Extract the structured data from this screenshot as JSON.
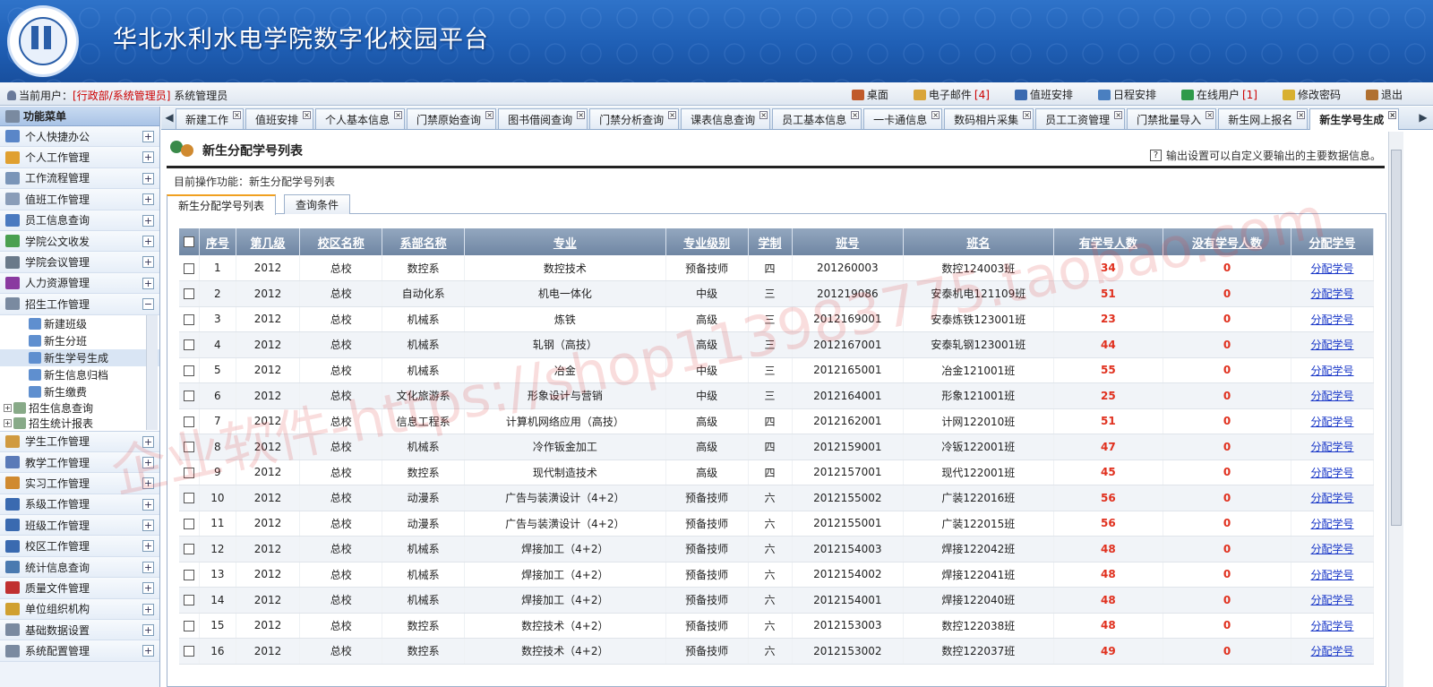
{
  "header": {
    "title": "华北水利水电学院数字化校园平台"
  },
  "userbar": {
    "label": "当前用户：",
    "role": "[行政部/系统管理员]",
    "name": "系统管理员",
    "nav": [
      {
        "label": "桌面",
        "icon": "home-icon",
        "color": "#c05a2a"
      },
      {
        "label": "电子邮件",
        "count": "[4]",
        "icon": "mail-icon",
        "color": "#d9a53a"
      },
      {
        "label": "值班安排",
        "icon": "duty-icon",
        "color": "#3a6ab0"
      },
      {
        "label": "日程安排",
        "icon": "clock-icon",
        "color": "#4a7fc0"
      },
      {
        "label": "在线用户",
        "count": "[1]",
        "icon": "users-icon",
        "color": "#2f9a4a"
      },
      {
        "label": "修改密码",
        "icon": "key-icon",
        "color": "#d8b030"
      },
      {
        "label": "退出",
        "icon": "exit-icon",
        "color": "#b07030"
      }
    ]
  },
  "sidebar": {
    "header": "功能菜单",
    "items_top": [
      {
        "label": "个人快捷办公",
        "color": "#5a86c8"
      },
      {
        "label": "个人工作管理",
        "color": "#e0a030"
      },
      {
        "label": "工作流程管理",
        "color": "#7a95b8"
      },
      {
        "label": "值班工作管理",
        "color": "#8a9db8"
      },
      {
        "label": "员工信息查询",
        "color": "#4a7ac0"
      },
      {
        "label": "学院公文收发",
        "color": "#4aa050"
      },
      {
        "label": "学院会议管理",
        "color": "#6a7a8a"
      },
      {
        "label": "人力资源管理",
        "color": "#8a3aa0"
      },
      {
        "label": "招生工作管理",
        "color": "#7a8aa0"
      }
    ],
    "sub_items": [
      {
        "label": "新建班级"
      },
      {
        "label": "新生分班"
      },
      {
        "label": "新生学号生成",
        "active": true
      },
      {
        "label": "新生信息归档"
      },
      {
        "label": "新生缴费"
      }
    ],
    "tree_items": [
      {
        "label": "招生信息查询"
      },
      {
        "label": "招生统计报表"
      }
    ],
    "items_bottom": [
      {
        "label": "学生工作管理",
        "color": "#d09a40"
      },
      {
        "label": "教学工作管理",
        "color": "#5a7ab8"
      },
      {
        "label": "实习工作管理",
        "color": "#d08a30"
      },
      {
        "label": "系级工作管理",
        "color": "#3a6ab0"
      },
      {
        "label": "班级工作管理",
        "color": "#3a6ab0"
      },
      {
        "label": "校区工作管理",
        "color": "#3a6ab0"
      },
      {
        "label": "统计信息查询",
        "color": "#4a7ab0"
      },
      {
        "label": "质量文件管理",
        "color": "#c03030"
      },
      {
        "label": "单位组织机构",
        "color": "#d0a030"
      },
      {
        "label": "基础数据设置",
        "color": "#7a8aa0"
      },
      {
        "label": "系统配置管理",
        "color": "#7a8aa0"
      }
    ]
  },
  "tabs": [
    "新建工作",
    "值班安排",
    "个人基本信息",
    "门禁原始查询",
    "图书借阅查询",
    "门禁分析查询",
    "课表信息查询",
    "员工基本信息",
    "一卡通信息",
    "数码相片采集",
    "员工工资管理",
    "门禁批量导入",
    "新生网上报名",
    "新生学号生成"
  ],
  "content": {
    "title": "新生分配学号列表",
    "hint": "输出设置可以自定义要输出的主要数据信息。",
    "current_op": "目前操作功能：新生分配学号列表",
    "subtabs": [
      "新生分配学号列表",
      "查询条件"
    ]
  },
  "table": {
    "columns": [
      "序号",
      "第几级",
      "校区名称",
      "系部名称",
      "专业",
      "专业级别",
      "学制",
      "班号",
      "班名",
      "有学号人数",
      "没有学号人数",
      "分配学号"
    ],
    "action_label": "分配学号",
    "rows": [
      [
        "1",
        "2012",
        "总校",
        "数控系",
        "数控技术",
        "预备技师",
        "四",
        "201260003",
        "数控124003班",
        "34",
        "0"
      ],
      [
        "2",
        "2012",
        "总校",
        "自动化系",
        "机电一体化",
        "中级",
        "三",
        "201219086",
        "安泰机电121109班",
        "51",
        "0"
      ],
      [
        "3",
        "2012",
        "总校",
        "机械系",
        "炼铁",
        "高级",
        "三",
        "2012169001",
        "安泰炼铁123001班",
        "23",
        "0"
      ],
      [
        "4",
        "2012",
        "总校",
        "机械系",
        "轧钢（高技）",
        "高级",
        "三",
        "2012167001",
        "安泰轧钢123001班",
        "44",
        "0"
      ],
      [
        "5",
        "2012",
        "总校",
        "机械系",
        "冶金",
        "中级",
        "三",
        "2012165001",
        "冶金121001班",
        "55",
        "0"
      ],
      [
        "6",
        "2012",
        "总校",
        "文化旅游系",
        "形象设计与营销",
        "中级",
        "三",
        "2012164001",
        "形象121001班",
        "25",
        "0"
      ],
      [
        "7",
        "2012",
        "总校",
        "信息工程系",
        "计算机网络应用（高技）",
        "高级",
        "四",
        "2012162001",
        "计网122010班",
        "51",
        "0"
      ],
      [
        "8",
        "2012",
        "总校",
        "机械系",
        "冷作钣金加工",
        "高级",
        "四",
        "2012159001",
        "冷钣122001班",
        "47",
        "0"
      ],
      [
        "9",
        "2012",
        "总校",
        "数控系",
        "现代制造技术",
        "高级",
        "四",
        "2012157001",
        "现代122001班",
        "45",
        "0"
      ],
      [
        "10",
        "2012",
        "总校",
        "动漫系",
        "广告与装潢设计（4+2）",
        "预备技师",
        "六",
        "2012155002",
        "广装122016班",
        "56",
        "0"
      ],
      [
        "11",
        "2012",
        "总校",
        "动漫系",
        "广告与装潢设计（4+2）",
        "预备技师",
        "六",
        "2012155001",
        "广装122015班",
        "56",
        "0"
      ],
      [
        "12",
        "2012",
        "总校",
        "机械系",
        "焊接加工（4+2）",
        "预备技师",
        "六",
        "2012154003",
        "焊接122042班",
        "48",
        "0"
      ],
      [
        "13",
        "2012",
        "总校",
        "机械系",
        "焊接加工（4+2）",
        "预备技师",
        "六",
        "2012154002",
        "焊接122041班",
        "48",
        "0"
      ],
      [
        "14",
        "2012",
        "总校",
        "机械系",
        "焊接加工（4+2）",
        "预备技师",
        "六",
        "2012154001",
        "焊接122040班",
        "48",
        "0"
      ],
      [
        "15",
        "2012",
        "总校",
        "数控系",
        "数控技术（4+2）",
        "预备技师",
        "六",
        "2012153003",
        "数控122038班",
        "48",
        "0"
      ],
      [
        "16",
        "2012",
        "总校",
        "数控系",
        "数控技术（4+2）",
        "预备技师",
        "六",
        "2012153002",
        "数控122037班",
        "49",
        "0"
      ]
    ]
  },
  "watermark": "企业软件-https://shop113983775.taobao.com"
}
